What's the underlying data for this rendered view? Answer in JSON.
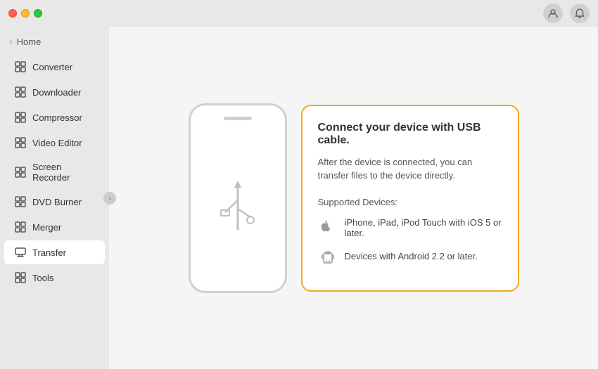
{
  "titleBar": {
    "trafficLights": [
      "close",
      "minimize",
      "maximize"
    ]
  },
  "sidebar": {
    "home": {
      "label": "Home",
      "chevron": "‹"
    },
    "items": [
      {
        "id": "converter",
        "label": "Converter",
        "active": false
      },
      {
        "id": "downloader",
        "label": "Downloader",
        "active": false
      },
      {
        "id": "compressor",
        "label": "Compressor",
        "active": false
      },
      {
        "id": "video-editor",
        "label": "Video Editor",
        "active": false
      },
      {
        "id": "screen-recorder",
        "label": "Screen Recorder",
        "active": false
      },
      {
        "id": "dvd-burner",
        "label": "DVD Burner",
        "active": false
      },
      {
        "id": "merger",
        "label": "Merger",
        "active": false
      },
      {
        "id": "transfer",
        "label": "Transfer",
        "active": true
      },
      {
        "id": "tools",
        "label": "Tools",
        "active": false
      }
    ]
  },
  "content": {
    "card": {
      "title": "Connect your device with USB cable.",
      "description": "After the device is connected, you can transfer files to the device directly.",
      "supportedLabel": "Supported Devices:",
      "devices": [
        {
          "id": "ios",
          "text": "iPhone, iPad, iPod Touch with iOS 5 or later."
        },
        {
          "id": "android",
          "text": "Devices with Android 2.2 or later."
        }
      ]
    }
  },
  "colors": {
    "accent": "#f5a623",
    "activeBackground": "#ffffff",
    "sidebarBackground": "#e8e8e8"
  }
}
